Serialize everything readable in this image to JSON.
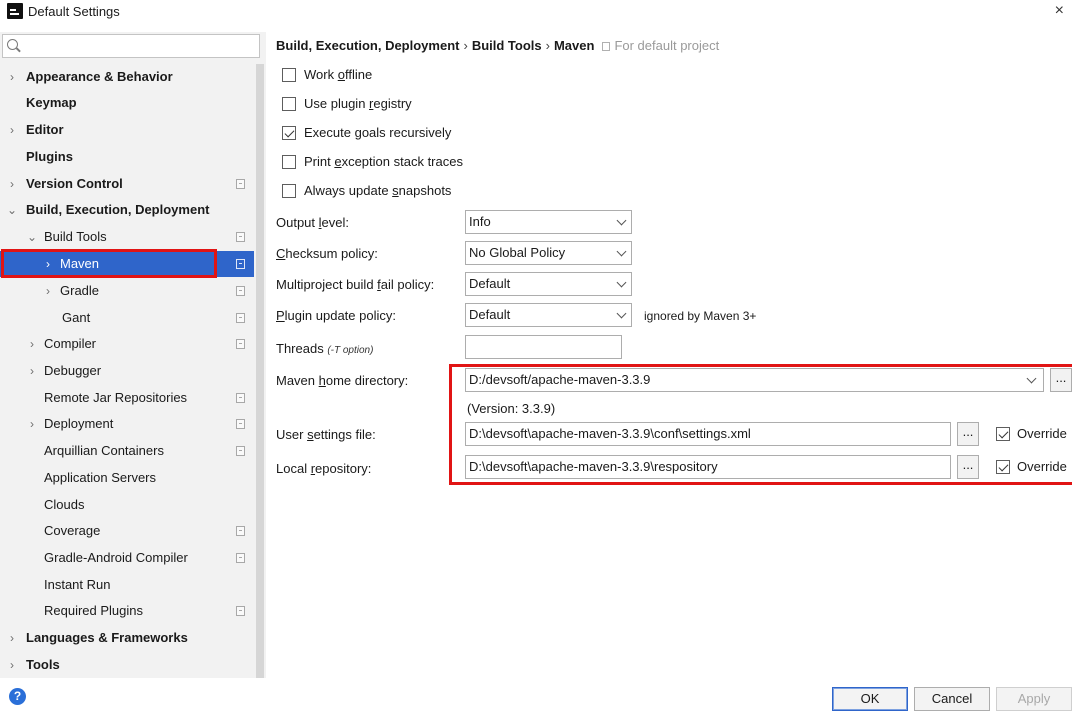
{
  "window": {
    "title": "Default Settings",
    "close_label": "×"
  },
  "sidebar": {
    "search_placeholder": "",
    "items": [
      {
        "label": "Appearance & Behavior",
        "arrow": "›",
        "bold": true
      },
      {
        "label": "Keymap",
        "arrow": "",
        "bold": true
      },
      {
        "label": "Editor",
        "arrow": "›",
        "bold": true
      },
      {
        "label": "Plugins",
        "arrow": "",
        "bold": true
      },
      {
        "label": "Version Control",
        "arrow": "›",
        "bold": true
      },
      {
        "label": "Build, Execution, Deployment",
        "arrow": "⌄",
        "bold": true
      },
      {
        "label": "Build Tools",
        "arrow": "⌄"
      },
      {
        "label": "Maven",
        "arrow": "›"
      },
      {
        "label": "Gradle",
        "arrow": "›"
      },
      {
        "label": "Gant",
        "arrow": ""
      },
      {
        "label": "Compiler",
        "arrow": "›"
      },
      {
        "label": "Debugger",
        "arrow": "›"
      },
      {
        "label": "Remote Jar Repositories",
        "arrow": ""
      },
      {
        "label": "Deployment",
        "arrow": "›"
      },
      {
        "label": "Arquillian Containers",
        "arrow": ""
      },
      {
        "label": "Application Servers",
        "arrow": ""
      },
      {
        "label": "Clouds",
        "arrow": ""
      },
      {
        "label": "Coverage",
        "arrow": ""
      },
      {
        "label": "Gradle-Android Compiler",
        "arrow": ""
      },
      {
        "label": "Instant Run",
        "arrow": ""
      },
      {
        "label": "Required Plugins",
        "arrow": ""
      },
      {
        "label": "Languages & Frameworks",
        "arrow": "›",
        "bold": true
      },
      {
        "label": "Tools",
        "arrow": "›",
        "bold": true
      }
    ]
  },
  "breadcrumb": {
    "part1": "Build, Execution, Deployment",
    "part2": "Build Tools",
    "part3": "Maven",
    "separator": "›",
    "scope": "For default project"
  },
  "options": {
    "work_offline": {
      "pre": "Work ",
      "key": "o",
      "post": "ffline",
      "checked": false
    },
    "use_plugin_registry": {
      "pre": "Use plugin ",
      "key": "r",
      "post": "egistry",
      "checked": false
    },
    "execute_goals": {
      "pre": "Execute ",
      "key": "g",
      "post": "oals recursively",
      "checked": true
    },
    "print_stack": {
      "pre": "Print ",
      "key": "e",
      "post": "xception stack traces",
      "checked": false
    },
    "always_update": {
      "pre": "Always update ",
      "key": "s",
      "post": "napshots",
      "checked": false
    }
  },
  "form": {
    "output_level": {
      "pre": "Output ",
      "key": "l",
      "post": "evel:",
      "value": "Info"
    },
    "checksum_policy": {
      "pre": "",
      "key": "C",
      "post": "hecksum policy:",
      "value": "No Global Policy"
    },
    "multiproject_policy": {
      "pre": "Multiproject build ",
      "key": "f",
      "post": "ail policy:",
      "value": "Default"
    },
    "plugin_update": {
      "pre": "",
      "key": "P",
      "post": "lugin update policy:",
      "value": "Default",
      "note": "ignored by Maven 3+"
    },
    "threads": {
      "label": "Threads",
      "hint": "(-T option)",
      "value": ""
    },
    "maven_home": {
      "pre": "Maven ",
      "key": "h",
      "post": "ome directory:",
      "value": "D:/devsoft/apache-maven-3.3.9",
      "version": "(Version: 3.3.9)"
    },
    "user_settings": {
      "pre": "User ",
      "key": "s",
      "post": "ettings file:",
      "value": "D:\\devsoft\\apache-maven-3.3.9\\conf\\settings.xml"
    },
    "local_repo": {
      "pre": "Local ",
      "key": "r",
      "post": "epository:",
      "value": "D:\\devsoft\\apache-maven-3.3.9\\respository"
    },
    "override_label": "Override",
    "browse_label": "..."
  },
  "buttons": {
    "ok": "OK",
    "cancel": "Cancel",
    "apply": "Apply",
    "help": "?"
  },
  "colors": {
    "selection": "#2f65ca",
    "highlight_annotation": "#e11414",
    "help": "#2a6fd8"
  }
}
